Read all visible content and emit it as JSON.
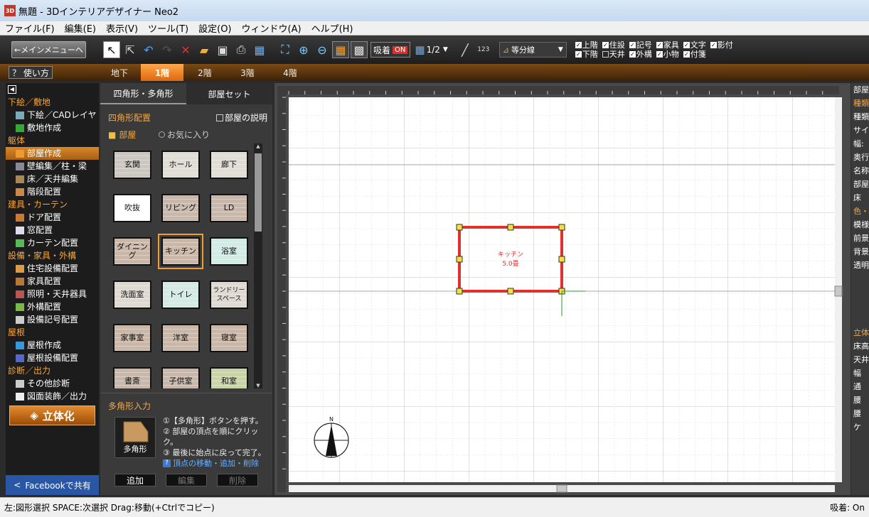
{
  "titlebar": {
    "app_icon": "3D",
    "title": "無題 - 3Dインテリアデザイナー Neo2"
  },
  "menubar": [
    "ファイル(F)",
    "編集(E)",
    "表示(V)",
    "ツール(T)",
    "設定(O)",
    "ウィンドウ(A)",
    "ヘルプ(H)"
  ],
  "toolbar": {
    "main_menu": "←メインメニューへ",
    "snap_label": "吸着",
    "snap_state": "ON",
    "grid_ratio": "1/2",
    "measure_label": "123",
    "divline_label": "等分線",
    "checks": [
      {
        "label": "上階",
        "checked": true
      },
      {
        "label": "住設",
        "checked": true
      },
      {
        "label": "記号",
        "checked": true
      },
      {
        "label": "家具",
        "checked": true
      },
      {
        "label": "文字",
        "checked": true
      },
      {
        "label": "影付",
        "checked": true
      },
      {
        "label": "下階",
        "checked": true
      },
      {
        "label": "天井",
        "checked": false
      },
      {
        "label": "外構",
        "checked": true
      },
      {
        "label": "小物",
        "checked": true
      },
      {
        "label": "付箋",
        "checked": true
      }
    ]
  },
  "floorbar": {
    "help": "？ 使い方",
    "floors": [
      "地下",
      "1階",
      "2階",
      "3階",
      "4階"
    ],
    "active": "1階"
  },
  "leftpanel": {
    "sections": [
      {
        "head": "下絵／敷地",
        "items": [
          "下絵／CADレイヤ",
          "敷地作成"
        ]
      },
      {
        "head": "躯体",
        "items": [
          "部屋作成",
          "壁編集／柱・梁",
          "床／天井編集",
          "階段配置"
        ]
      },
      {
        "head": "建具・カーテン",
        "items": [
          "ドア配置",
          "窓配置",
          "カーテン配置"
        ]
      },
      {
        "head": "設備・家具・外構",
        "items": [
          "住宅設備配置",
          "家具配置",
          "照明・天井器具",
          "外構配置",
          "設備記号配置"
        ]
      },
      {
        "head": "屋根",
        "items": [
          "屋根作成",
          "屋根設備配置"
        ]
      },
      {
        "head": "診断／出力",
        "items": [
          "その他診断",
          "図面装飾／出力"
        ]
      }
    ],
    "active_item": "部屋作成",
    "rittaika": "立体化",
    "facebook": "Facebookで共有"
  },
  "midpanel": {
    "tabs": [
      "四角形・多角形",
      "部屋セット"
    ],
    "placement_label": "四角形配置",
    "room_desc": "部屋の説明",
    "room_folder": "部屋",
    "favorites": "お気に入り",
    "rooms": [
      {
        "label": "玄関",
        "bg": "#cbc6c0"
      },
      {
        "label": "ホール",
        "bg": "#e0dcd6"
      },
      {
        "label": "廊下",
        "bg": "#e0dcd6"
      },
      {
        "label": "吹抜",
        "bg": "#ffffff"
      },
      {
        "label": "リビング",
        "bg": "#c9b8aa"
      },
      {
        "label": "LD",
        "bg": "#c9b8aa"
      },
      {
        "label": "ダイニング",
        "bg": "#c9b8aa"
      },
      {
        "label": "キッチン",
        "bg": "#c9b8aa"
      },
      {
        "label": "浴室",
        "bg": "#d3eae5"
      },
      {
        "label": "洗面室",
        "bg": "#ded8d0"
      },
      {
        "label": "トイレ",
        "bg": "#d3eae5"
      },
      {
        "label": "ランドリースペース",
        "bg": "#ded8d0"
      },
      {
        "label": "家事室",
        "bg": "#c9b8aa"
      },
      {
        "label": "洋室",
        "bg": "#c9b8aa"
      },
      {
        "label": "寝室",
        "bg": "#c9b8aa"
      },
      {
        "label": "書斎",
        "bg": "#c9b8aa"
      },
      {
        "label": "子供室",
        "bg": "#c9b8aa"
      },
      {
        "label": "和室",
        "bg": "#c8d6a4"
      }
    ],
    "selected_room": "キッチン",
    "polygon_label": "多角形入力",
    "polygon_button": "多角形",
    "steps": [
      "①【多角形】ボタンを押す。",
      "② 部屋の頂点を順にクリック。",
      "③ 最後に始点に戻って完了。"
    ],
    "steps_link": "頂点の移動・追加・削除",
    "buttons": [
      "追加",
      "編集",
      "削除"
    ]
  },
  "canvas": {
    "room_name": "キッチン",
    "room_area": "5.0畳",
    "north": "N",
    "room_color": "#e03030",
    "handle_color": "#f0e040"
  },
  "rightpanel": [
    "部屋",
    "種類",
    "種類",
    "サイ",
    "幅:",
    "奥行",
    "名称",
    "部屋",
    "床",
    "色・",
    "模様",
    "前景",
    "背景",
    "透明",
    "",
    "",
    "",
    "",
    "立体",
    "床高",
    "天井",
    "幅",
    "通",
    "腰",
    "腰",
    "ケ"
  ],
  "statusbar": {
    "left": "左:図形選択 SPACE:次選択 Drag:移動(+Ctrlでコピー)",
    "right": "吸着: On"
  }
}
